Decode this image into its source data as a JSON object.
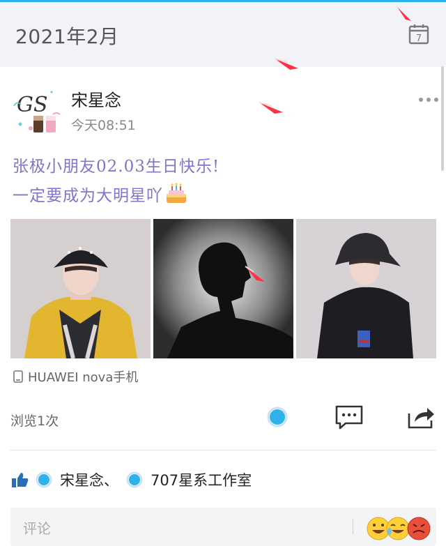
{
  "header": {
    "month_title": "2021年2月",
    "calendar_day": "7"
  },
  "post": {
    "author": "宋星念",
    "avatar_text": "GS",
    "time": "今天08:51",
    "text_lines": [
      "张极小朋友02.03生日快乐!",
      "一定要成为大明星吖"
    ],
    "device": "HUAWEI nova手机",
    "views": "浏览1次"
  },
  "likes": {
    "names": [
      "宋星念",
      "707星系工作室"
    ],
    "separator": "、"
  },
  "comment": {
    "placeholder": "评论"
  },
  "icons": [
    "calendar-icon",
    "more-icon",
    "cake-icon",
    "phone-icon",
    "vip-icon",
    "comment-icon",
    "share-icon",
    "thumb-up-icon",
    "badge-icon",
    "emoji-icon"
  ],
  "colors": {
    "accent": "#27b3e8",
    "post_text": "#8473c8",
    "header_bg": "#f2f3f7",
    "sparkle": "#ff3048"
  }
}
